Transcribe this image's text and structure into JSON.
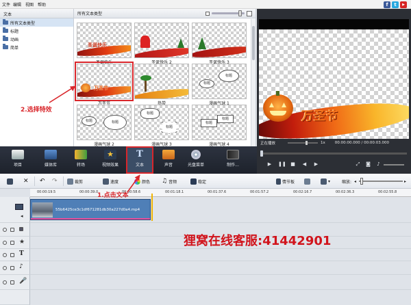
{
  "menu": {
    "file": "文件",
    "edit": "编辑",
    "view": "视图",
    "help": "帮助"
  },
  "social": {
    "facebook": "f",
    "twitter": "t",
    "youtube": "▶"
  },
  "left_panel": {
    "header": "文本",
    "items": [
      {
        "label": "所有文本类型",
        "selected": true
      },
      {
        "label": "标题",
        "selected": false
      },
      {
        "label": "动画",
        "selected": false
      },
      {
        "label": "简单",
        "selected": false
      }
    ]
  },
  "gallery": {
    "header": "所有文本类型",
    "tiles": [
      {
        "caption": "圣诞快乐",
        "title": "圣诞快乐"
      },
      {
        "caption": "圣诞快乐 2",
        "title": ""
      },
      {
        "caption": "圣诞快乐 3",
        "title": ""
      },
      {
        "caption": "万圣节",
        "title": "万圣节"
      },
      {
        "caption": "热带",
        "title": ""
      },
      {
        "caption": "漫画气球 1",
        "title": "",
        "bubble": "标题"
      },
      {
        "caption": "漫画气球 2",
        "title": "",
        "bubble": "标题"
      },
      {
        "caption": "漫画气球 3",
        "title": "",
        "bubble": "标题"
      },
      {
        "caption": "漫画气球 4",
        "title": "",
        "bubble": "标题"
      }
    ]
  },
  "preview": {
    "title_text": "万圣节",
    "status": "正在播放",
    "speed": "1x",
    "time": "00:00:00.000 / 00:00:03.000"
  },
  "ribbon": {
    "buttons": [
      {
        "label": "项目",
        "icon": "clapper-icon"
      },
      {
        "label": "媒体库",
        "icon": "film-icon"
      },
      {
        "label": "转场",
        "icon": "transition-icon"
      },
      {
        "label": "视频效果",
        "icon": "star-icon"
      },
      {
        "label": "文本",
        "icon": "text-t-icon",
        "active": true
      },
      {
        "label": "声音",
        "icon": "music-icon"
      },
      {
        "label": "光盘菜单",
        "icon": "disc-icon"
      },
      {
        "label": "制作...",
        "icon": "film-produce-icon"
      }
    ]
  },
  "toolbar": {
    "crop": "裁剪",
    "speed": "速度",
    "color": "颜色",
    "audio": "音频",
    "stabilize": "稳定",
    "storyboard": "情节板",
    "zoom": "缩放:"
  },
  "ruler": {
    "ticks": [
      "00:00:19.5",
      "00:00:39.0",
      "00:00:58.6",
      "00:01:18.1",
      "00:01:37.6",
      "00:01:57.2",
      "00:02:16.7",
      "00:02:36.3",
      "00:02:55.8"
    ]
  },
  "clip": {
    "filename": "55b6425ce3c1df671281db30a227d0a4.mp4"
  },
  "annotations": {
    "step1": "1.点击文本",
    "step2": "2.选择特效"
  },
  "watermark": "狸窝在线客服:41442901",
  "colors": {
    "accent_red": "#d9262b",
    "ribbon_bg": "#1d222b",
    "clip_blue": "#4f7fb7"
  }
}
